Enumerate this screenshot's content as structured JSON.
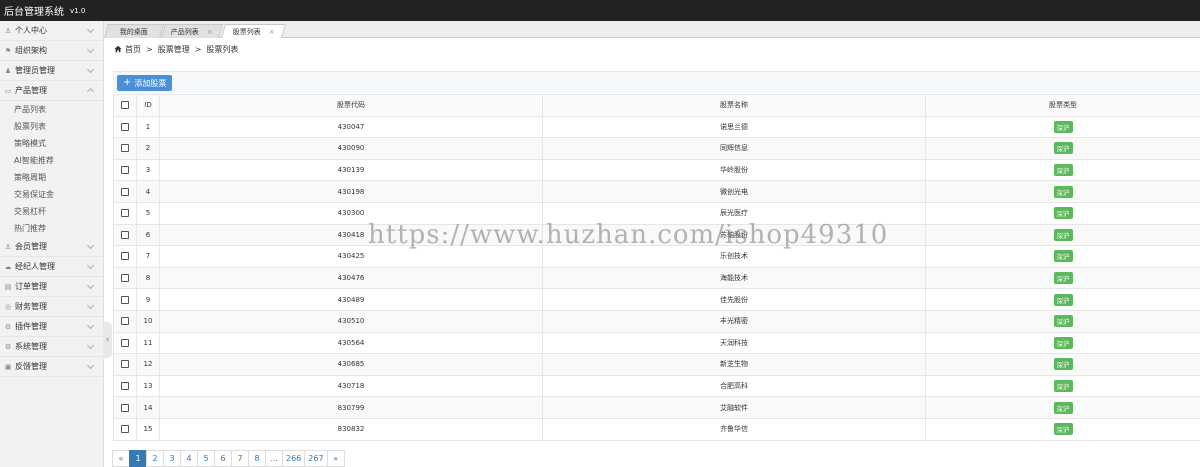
{
  "app": {
    "title": "后台管理系统",
    "version": "v1.0"
  },
  "sidebar": {
    "items": [
      {
        "label": "个人中心",
        "icon": "user-icon",
        "expanded": false
      },
      {
        "label": "组织架构",
        "icon": "org-icon",
        "expanded": false
      },
      {
        "label": "管理员管理",
        "icon": "admin-icon",
        "expanded": false
      },
      {
        "label": "产品管理",
        "icon": "product-icon",
        "expanded": true,
        "children": [
          "产品列表",
          "股票列表",
          "策略模式",
          "AI智能推荐",
          "策略周期",
          "交易保证金",
          "交易杠杆",
          "热门推荐"
        ]
      },
      {
        "label": "会员管理",
        "icon": "member-icon",
        "expanded": false
      },
      {
        "label": "经纪人管理",
        "icon": "broker-icon",
        "expanded": false
      },
      {
        "label": "订单管理",
        "icon": "order-icon",
        "expanded": false
      },
      {
        "label": "财务管理",
        "icon": "finance-icon",
        "expanded": false
      },
      {
        "label": "插件管理",
        "icon": "plugin-icon",
        "expanded": false
      },
      {
        "label": "系统管理",
        "icon": "system-icon",
        "expanded": false
      },
      {
        "label": "反馈管理",
        "icon": "feedback-icon",
        "expanded": false
      }
    ]
  },
  "tabs": [
    {
      "label": "我的桌面",
      "active": false,
      "closable": false
    },
    {
      "label": "产品列表",
      "active": false,
      "closable": true
    },
    {
      "label": "股票列表",
      "active": true,
      "closable": true
    }
  ],
  "tab_close_glyph": "×",
  "breadcrumb": {
    "home": "首页",
    "level1": "股票管理",
    "level2": "股票列表",
    "separator": ">"
  },
  "toolbar": {
    "add_label": "添加股票",
    "add_icon": "+"
  },
  "table": {
    "headers": {
      "id": "ID",
      "code": "股票代码",
      "name": "股票名称",
      "type": "股票类型"
    },
    "rows": [
      {
        "id": "1",
        "code": "430047",
        "name": "诺思兰德",
        "type": "深沪"
      },
      {
        "id": "2",
        "code": "430090",
        "name": "同辉信息",
        "type": "深沪"
      },
      {
        "id": "3",
        "code": "430139",
        "name": "华岭股份",
        "type": "深沪"
      },
      {
        "id": "4",
        "code": "430198",
        "name": "微创光电",
        "type": "深沪"
      },
      {
        "id": "5",
        "code": "430300",
        "name": "辰光医疗",
        "type": "深沪"
      },
      {
        "id": "6",
        "code": "430418",
        "name": "苏轴股份",
        "type": "深沪"
      },
      {
        "id": "7",
        "code": "430425",
        "name": "乐创技术",
        "type": "深沪"
      },
      {
        "id": "8",
        "code": "430476",
        "name": "海能技术",
        "type": "深沪"
      },
      {
        "id": "9",
        "code": "430489",
        "name": "佳先股份",
        "type": "深沪"
      },
      {
        "id": "10",
        "code": "430510",
        "name": "丰光精密",
        "type": "深沪"
      },
      {
        "id": "11",
        "code": "430564",
        "name": "天润科技",
        "type": "深沪"
      },
      {
        "id": "12",
        "code": "430685",
        "name": "新芝生物",
        "type": "深沪"
      },
      {
        "id": "13",
        "code": "430718",
        "name": "合肥高科",
        "type": "深沪"
      },
      {
        "id": "14",
        "code": "830799",
        "name": "艾融软件",
        "type": "深沪"
      },
      {
        "id": "15",
        "code": "830832",
        "name": "齐鲁华信",
        "type": "深沪"
      }
    ]
  },
  "pagination": {
    "prev": "«",
    "next": "»",
    "pages": [
      "1",
      "2",
      "3",
      "4",
      "5",
      "6",
      "7",
      "8",
      "...",
      "266",
      "267"
    ],
    "current": "1"
  },
  "watermark": "https://www.huzhan.com/ishop49310",
  "colors": {
    "topbar": "#222222",
    "primary": "#4a90d9",
    "badge": "#5cb85c",
    "active_page": "#337ab7"
  }
}
